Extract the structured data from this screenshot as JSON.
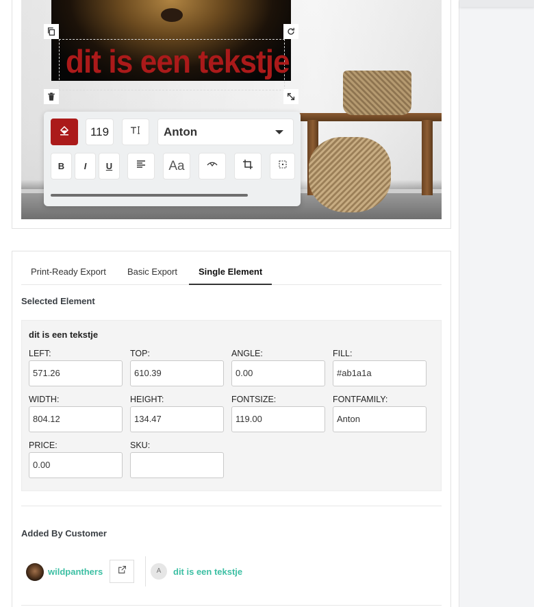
{
  "canvas": {
    "text": "dit is een tekstje",
    "text_color": "#ab1a1a"
  },
  "text_toolbar": {
    "fill_color": "#ab1a1a",
    "font_size": "119",
    "font_family": "Anton",
    "icons": [
      "fill-bucket-icon",
      "text-size-icon",
      "bold-icon",
      "italic-icon",
      "underline-icon",
      "align-left-icon",
      "font-style-icon",
      "curve-text-icon",
      "crop-icon",
      "more-options-icon"
    ],
    "labels": {
      "bold": "B",
      "italic": "I",
      "underline": "U",
      "font_style": "Aa"
    }
  },
  "tabs": [
    {
      "label": "Print-Ready Export",
      "active": false
    },
    {
      "label": "Basic Export",
      "active": false
    },
    {
      "label": "Single Element",
      "active": true
    }
  ],
  "selected_element": {
    "heading": "Selected Element",
    "name": "dit is een tekstje",
    "fields": {
      "left": {
        "label": "LEFT:",
        "value": "571.26"
      },
      "top": {
        "label": "TOP:",
        "value": "610.39"
      },
      "angle": {
        "label": "ANGLE:",
        "value": "0.00"
      },
      "fill": {
        "label": "FILL:",
        "value": "#ab1a1a"
      },
      "width": {
        "label": "WIDTH:",
        "value": "804.12"
      },
      "height": {
        "label": "HEIGHT:",
        "value": "134.47"
      },
      "fontsize": {
        "label": "FONTSIZE:",
        "value": "119.00"
      },
      "fontfamily": {
        "label": "FONTFAMILY:",
        "value": "Anton"
      },
      "price": {
        "label": "PRICE:",
        "value": "0.00"
      },
      "sku": {
        "label": "SKU:",
        "value": ""
      }
    }
  },
  "added_by_customer": {
    "heading": "Added By Customer",
    "user": "wildpanthers",
    "item_avatar_letter": "A",
    "item": "dit is een tekstje"
  }
}
